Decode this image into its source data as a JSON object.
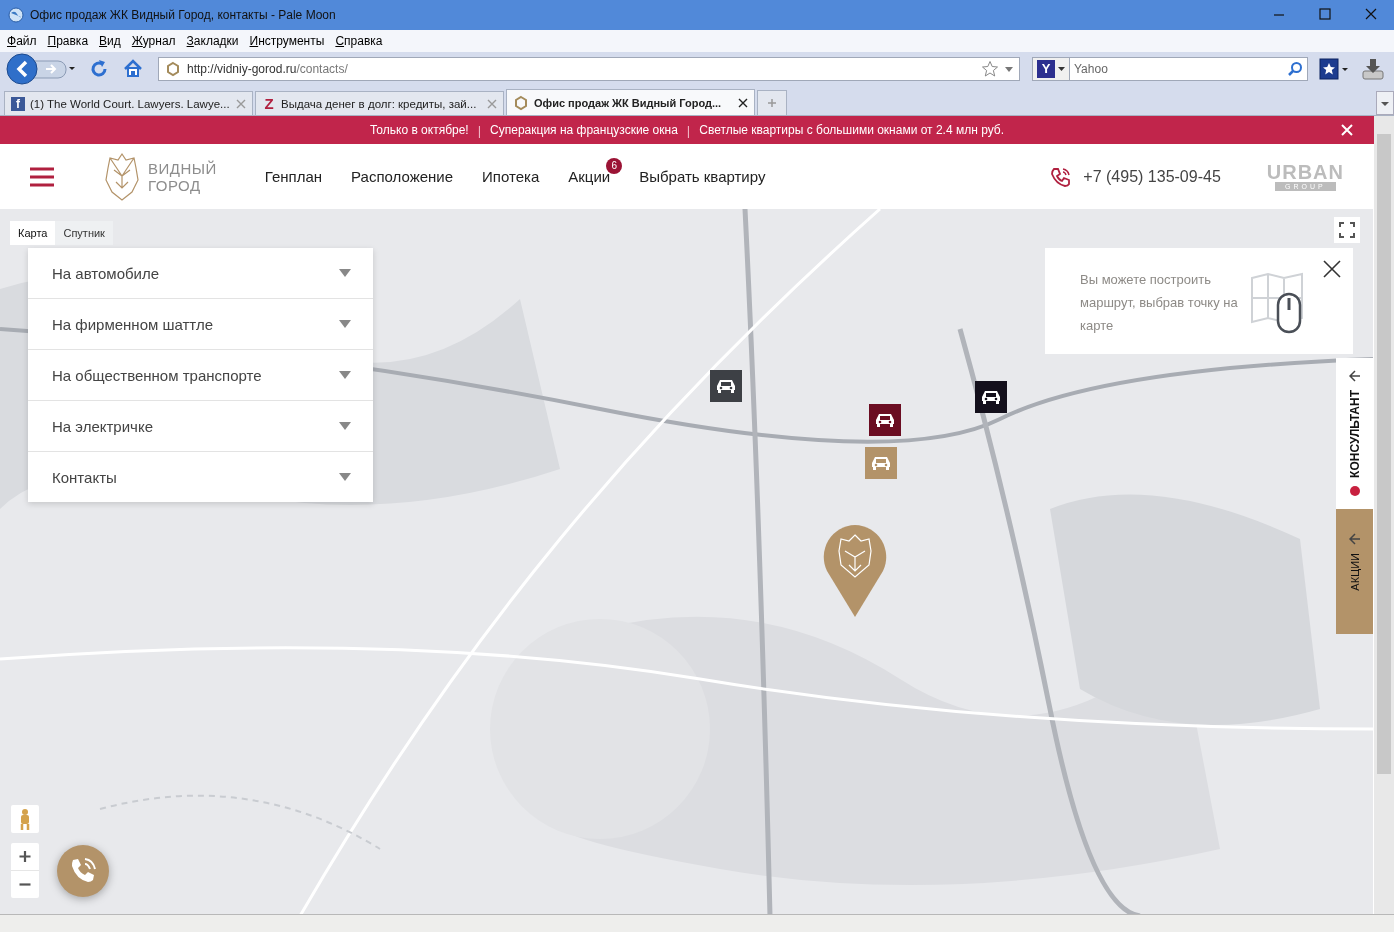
{
  "window": {
    "title": "Офис продаж ЖК Видный Город, контакты - Pale Moon"
  },
  "menu_bar": {
    "items": [
      "Файл",
      "Правка",
      "Вид",
      "Журнал",
      "Закладки",
      "Инструменты",
      "Справка"
    ]
  },
  "nav_bar": {
    "url_host": "http://vidniy-gorod.ru",
    "url_path": "/contacts/",
    "search_engine": "Y",
    "search_placeholder": "Yahoo"
  },
  "tabs": [
    {
      "label": "(1) The World Court. Lawyers. Lawye...",
      "kind": "facebook",
      "icon_text": "f",
      "selected": false
    },
    {
      "label": "Выдача денег в долг: кредиты, зай...",
      "kind": "letter",
      "icon_text": "Z",
      "selected": false
    },
    {
      "label": "Офис продаж ЖК Видный Город...",
      "kind": "hexagon",
      "selected": true
    }
  ],
  "promo_bar": {
    "segments": [
      {
        "kind": "text",
        "text": "Только в октябре!"
      },
      {
        "kind": "separator",
        "text": "|"
      },
      {
        "kind": "text",
        "text": "Суперакция на французские окна"
      },
      {
        "kind": "separator",
        "text": "|"
      },
      {
        "kind": "text",
        "text": "Светлые квартиры с большими окнами от 2.4 млн руб."
      }
    ]
  },
  "header": {
    "logo_lines": [
      "ВИДНЫЙ",
      "ГОРОД"
    ],
    "nav": [
      {
        "label": "Генплан"
      },
      {
        "label": "Расположение"
      },
      {
        "label": "Ипотека"
      },
      {
        "label": "Акции",
        "badge": "6"
      },
      {
        "label": "Выбрать квартиру"
      }
    ],
    "phone": "+7 (495) 135-09-45",
    "partner_logo": [
      "URBAN",
      "GROUP"
    ]
  },
  "map": {
    "kind": "picture",
    "type_tabs": [
      {
        "label": "Карта",
        "selected": true
      },
      {
        "label": "Спутник",
        "selected": false
      }
    ],
    "route_menu": [
      {
        "label": "На автомобиле",
        "expanded": false
      },
      {
        "label": "На фирменном шаттле",
        "expanded": false
      },
      {
        "label": "На общественном транспорте",
        "expanded": false
      },
      {
        "label": "На электричке",
        "expanded": false
      },
      {
        "label": "Контакты",
        "expanded": false
      }
    ],
    "hint": {
      "text": "Вы можете построить маршрут, выбрав точку на карте"
    },
    "parking_markers": [
      {
        "color": "#3d4045"
      },
      {
        "color": "#6b0d22"
      },
      {
        "color": "#b39369"
      },
      {
        "color": "#14101c"
      }
    ],
    "side_tabs": [
      {
        "kind": "consultant",
        "label": "КОНСУЛЬТАНТ"
      },
      {
        "kind": "promo",
        "label": "АКЦИИ"
      }
    ]
  }
}
